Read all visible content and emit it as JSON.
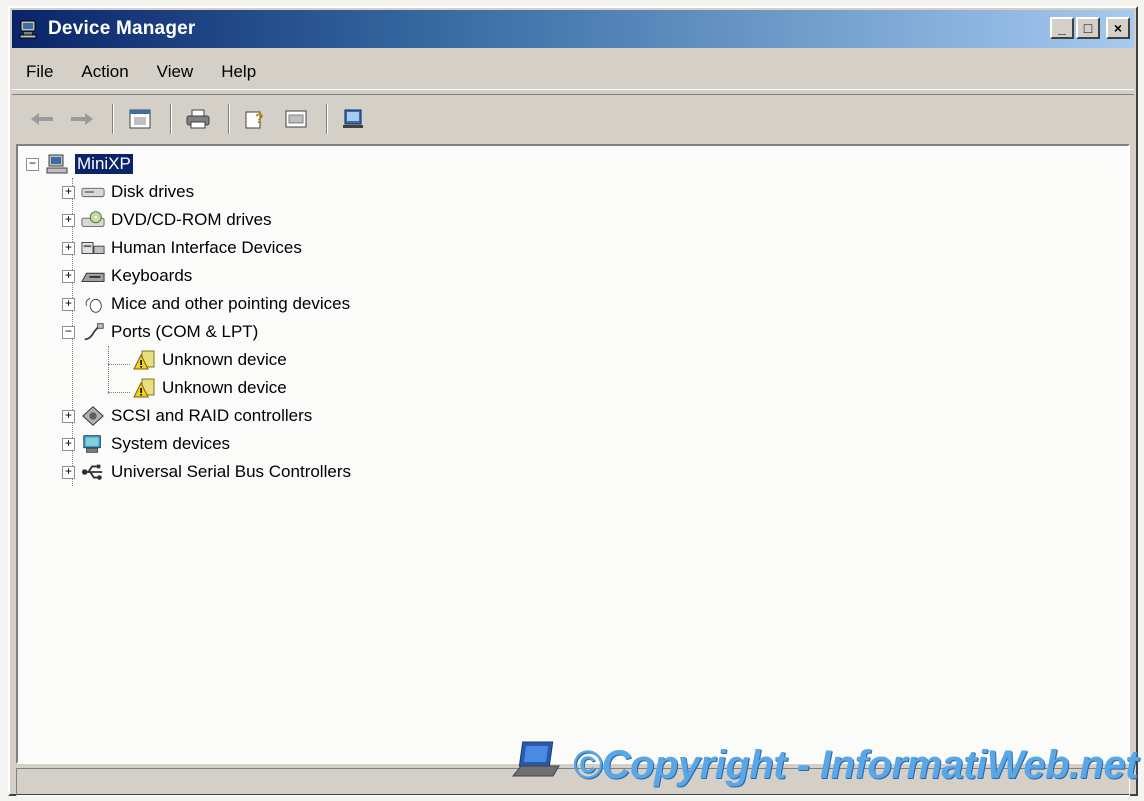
{
  "window": {
    "title": "Device Manager",
    "buttons": {
      "minimize": "_",
      "maximize": "□",
      "close": "×"
    }
  },
  "menu": [
    "File",
    "Action",
    "View",
    "Help"
  ],
  "toolbar": [
    "back-arrow-icon",
    "forward-arrow-icon",
    "properties-icon",
    "print-icon",
    "help-icon",
    "view-icon",
    "update-driver-icon"
  ],
  "tree": {
    "root": "MiniXP",
    "categories": [
      {
        "label": "Disk drives",
        "expanded": false
      },
      {
        "label": "DVD/CD-ROM drives",
        "expanded": false
      },
      {
        "label": "Human Interface Devices",
        "expanded": false
      },
      {
        "label": "Keyboards",
        "expanded": false
      },
      {
        "label": "Mice and other pointing devices",
        "expanded": false
      },
      {
        "label": "Ports (COM & LPT)",
        "expanded": true,
        "children": [
          "Unknown device",
          "Unknown device"
        ]
      },
      {
        "label": "SCSI and RAID controllers",
        "expanded": false
      },
      {
        "label": "System devices",
        "expanded": false
      },
      {
        "label": "Universal Serial Bus Controllers",
        "expanded": false
      }
    ]
  },
  "watermark": "©Copyright - InformatiWeb.net",
  "colors": {
    "titlebar_start": "#0a246a",
    "titlebar_end": "#a6caf0",
    "selection": "#0a246a",
    "watermark": "#5aa7e8"
  }
}
